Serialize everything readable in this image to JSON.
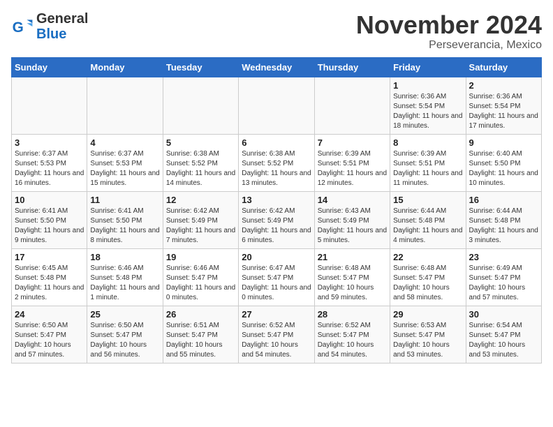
{
  "header": {
    "logo_general": "General",
    "logo_blue": "Blue",
    "month_title": "November 2024",
    "subtitle": "Perseverancia, Mexico"
  },
  "weekdays": [
    "Sunday",
    "Monday",
    "Tuesday",
    "Wednesday",
    "Thursday",
    "Friday",
    "Saturday"
  ],
  "weeks": [
    [
      {
        "day": "",
        "info": ""
      },
      {
        "day": "",
        "info": ""
      },
      {
        "day": "",
        "info": ""
      },
      {
        "day": "",
        "info": ""
      },
      {
        "day": "",
        "info": ""
      },
      {
        "day": "1",
        "info": "Sunrise: 6:36 AM\nSunset: 5:54 PM\nDaylight: 11 hours and 18 minutes."
      },
      {
        "day": "2",
        "info": "Sunrise: 6:36 AM\nSunset: 5:54 PM\nDaylight: 11 hours and 17 minutes."
      }
    ],
    [
      {
        "day": "3",
        "info": "Sunrise: 6:37 AM\nSunset: 5:53 PM\nDaylight: 11 hours and 16 minutes."
      },
      {
        "day": "4",
        "info": "Sunrise: 6:37 AM\nSunset: 5:53 PM\nDaylight: 11 hours and 15 minutes."
      },
      {
        "day": "5",
        "info": "Sunrise: 6:38 AM\nSunset: 5:52 PM\nDaylight: 11 hours and 14 minutes."
      },
      {
        "day": "6",
        "info": "Sunrise: 6:38 AM\nSunset: 5:52 PM\nDaylight: 11 hours and 13 minutes."
      },
      {
        "day": "7",
        "info": "Sunrise: 6:39 AM\nSunset: 5:51 PM\nDaylight: 11 hours and 12 minutes."
      },
      {
        "day": "8",
        "info": "Sunrise: 6:39 AM\nSunset: 5:51 PM\nDaylight: 11 hours and 11 minutes."
      },
      {
        "day": "9",
        "info": "Sunrise: 6:40 AM\nSunset: 5:50 PM\nDaylight: 11 hours and 10 minutes."
      }
    ],
    [
      {
        "day": "10",
        "info": "Sunrise: 6:41 AM\nSunset: 5:50 PM\nDaylight: 11 hours and 9 minutes."
      },
      {
        "day": "11",
        "info": "Sunrise: 6:41 AM\nSunset: 5:50 PM\nDaylight: 11 hours and 8 minutes."
      },
      {
        "day": "12",
        "info": "Sunrise: 6:42 AM\nSunset: 5:49 PM\nDaylight: 11 hours and 7 minutes."
      },
      {
        "day": "13",
        "info": "Sunrise: 6:42 AM\nSunset: 5:49 PM\nDaylight: 11 hours and 6 minutes."
      },
      {
        "day": "14",
        "info": "Sunrise: 6:43 AM\nSunset: 5:49 PM\nDaylight: 11 hours and 5 minutes."
      },
      {
        "day": "15",
        "info": "Sunrise: 6:44 AM\nSunset: 5:48 PM\nDaylight: 11 hours and 4 minutes."
      },
      {
        "day": "16",
        "info": "Sunrise: 6:44 AM\nSunset: 5:48 PM\nDaylight: 11 hours and 3 minutes."
      }
    ],
    [
      {
        "day": "17",
        "info": "Sunrise: 6:45 AM\nSunset: 5:48 PM\nDaylight: 11 hours and 2 minutes."
      },
      {
        "day": "18",
        "info": "Sunrise: 6:46 AM\nSunset: 5:48 PM\nDaylight: 11 hours and 1 minute."
      },
      {
        "day": "19",
        "info": "Sunrise: 6:46 AM\nSunset: 5:47 PM\nDaylight: 11 hours and 0 minutes."
      },
      {
        "day": "20",
        "info": "Sunrise: 6:47 AM\nSunset: 5:47 PM\nDaylight: 11 hours and 0 minutes."
      },
      {
        "day": "21",
        "info": "Sunrise: 6:48 AM\nSunset: 5:47 PM\nDaylight: 10 hours and 59 minutes."
      },
      {
        "day": "22",
        "info": "Sunrise: 6:48 AM\nSunset: 5:47 PM\nDaylight: 10 hours and 58 minutes."
      },
      {
        "day": "23",
        "info": "Sunrise: 6:49 AM\nSunset: 5:47 PM\nDaylight: 10 hours and 57 minutes."
      }
    ],
    [
      {
        "day": "24",
        "info": "Sunrise: 6:50 AM\nSunset: 5:47 PM\nDaylight: 10 hours and 57 minutes."
      },
      {
        "day": "25",
        "info": "Sunrise: 6:50 AM\nSunset: 5:47 PM\nDaylight: 10 hours and 56 minutes."
      },
      {
        "day": "26",
        "info": "Sunrise: 6:51 AM\nSunset: 5:47 PM\nDaylight: 10 hours and 55 minutes."
      },
      {
        "day": "27",
        "info": "Sunrise: 6:52 AM\nSunset: 5:47 PM\nDaylight: 10 hours and 54 minutes."
      },
      {
        "day": "28",
        "info": "Sunrise: 6:52 AM\nSunset: 5:47 PM\nDaylight: 10 hours and 54 minutes."
      },
      {
        "day": "29",
        "info": "Sunrise: 6:53 AM\nSunset: 5:47 PM\nDaylight: 10 hours and 53 minutes."
      },
      {
        "day": "30",
        "info": "Sunrise: 6:54 AM\nSunset: 5:47 PM\nDaylight: 10 hours and 53 minutes."
      }
    ]
  ]
}
